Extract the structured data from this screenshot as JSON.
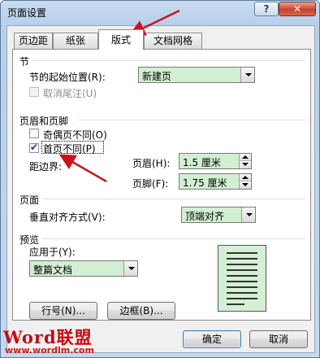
{
  "window": {
    "title": "页面设置",
    "help_label": "?",
    "close_label": "✕"
  },
  "tabs": [
    {
      "label": "页边距",
      "active": false
    },
    {
      "label": "纸张",
      "active": false
    },
    {
      "label": "版式",
      "active": true
    },
    {
      "label": "文档网格",
      "active": false
    }
  ],
  "section": {
    "title": "节",
    "start_label": "节的起始位置(R):",
    "start_value": "新建页",
    "suppress_endnotes_label": "取消尾注(U)"
  },
  "headers_footers": {
    "title": "页眉和页脚",
    "odd_even_label": "奇偶页不同(O)",
    "odd_even_checked": false,
    "first_page_label": "首页不同(P)",
    "first_page_checked": true,
    "from_edge_label": "距边界:",
    "header_label": "页眉(H):",
    "header_value": "1.5 厘米",
    "footer_label": "页脚(F):",
    "footer_value": "1.75 厘米"
  },
  "page": {
    "title": "页面",
    "vertical_align_label": "垂直对齐方式(V):",
    "vertical_align_value": "顶端对齐"
  },
  "preview": {
    "title": "预览",
    "apply_to_label": "应用于(Y):",
    "apply_to_value": "整篇文档"
  },
  "buttons": {
    "line_numbers": "行号(N)...",
    "borders": "边框(B)...",
    "ok": "确定",
    "cancel": "取消"
  },
  "watermark": {
    "brand": "Word联盟",
    "url": "www.wordlm.com"
  },
  "colors": {
    "field_bg": "#d2efd2",
    "annotation_arrow": "#c8141e",
    "titlebar": "#b7cfe9"
  }
}
